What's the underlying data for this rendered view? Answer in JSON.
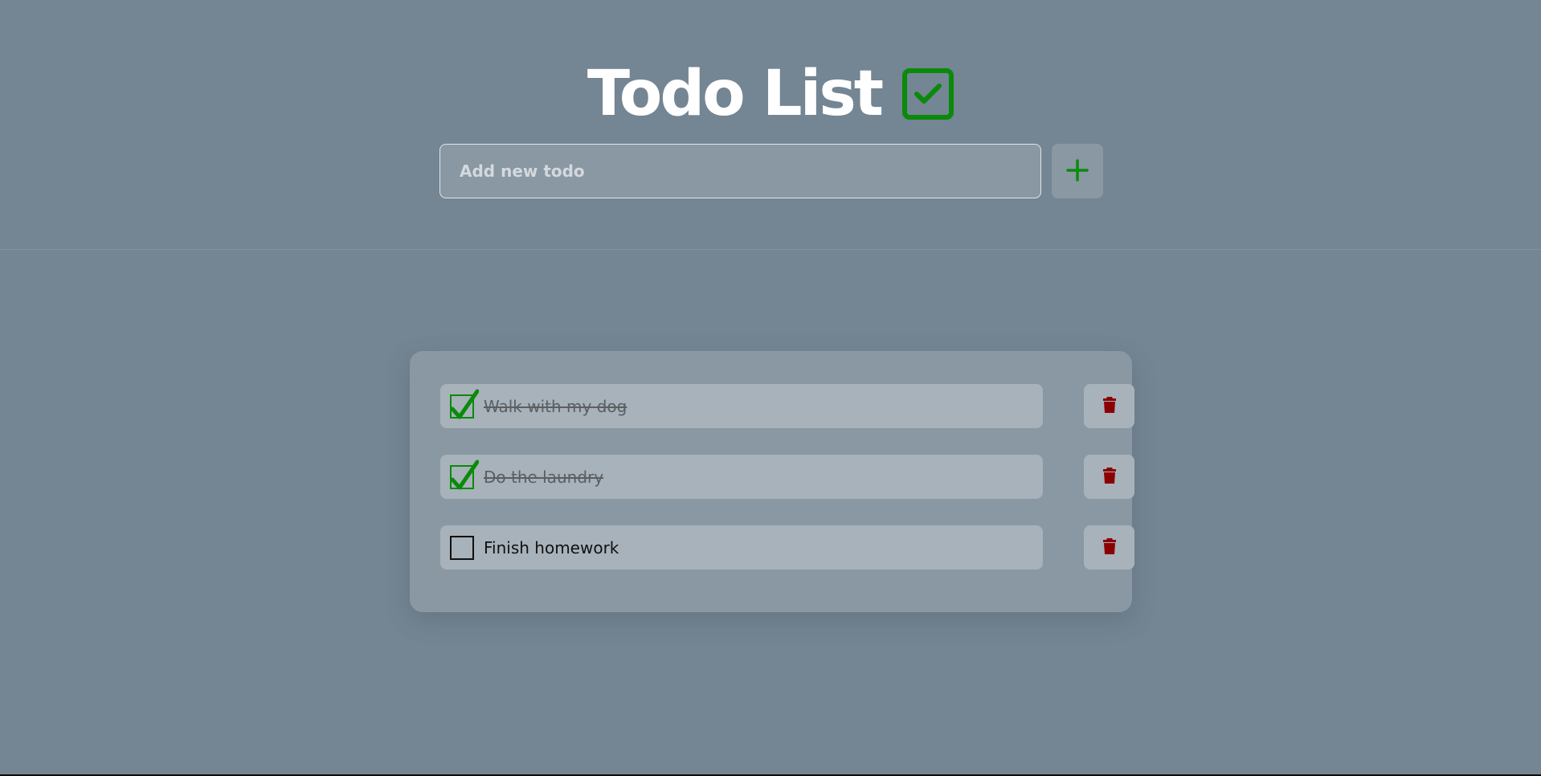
{
  "header": {
    "title": "Todo List",
    "title_icon": "check-square-icon"
  },
  "add_form": {
    "placeholder": "Add new todo",
    "button_icon": "plus-icon"
  },
  "todos": [
    {
      "text": "Walk with my dog",
      "completed": true
    },
    {
      "text": "Do the laundry",
      "completed": true
    },
    {
      "text": "Finish homework",
      "completed": false
    }
  ],
  "icons": {
    "delete": "trash-icon",
    "done": "checkmark-icon"
  },
  "colors": {
    "background": "#748593",
    "panel": "#8a98a3",
    "item": "#a8b2ba",
    "accent_green": "#0a8a0a",
    "delete_red": "#8b0000",
    "title": "#ffffff"
  }
}
